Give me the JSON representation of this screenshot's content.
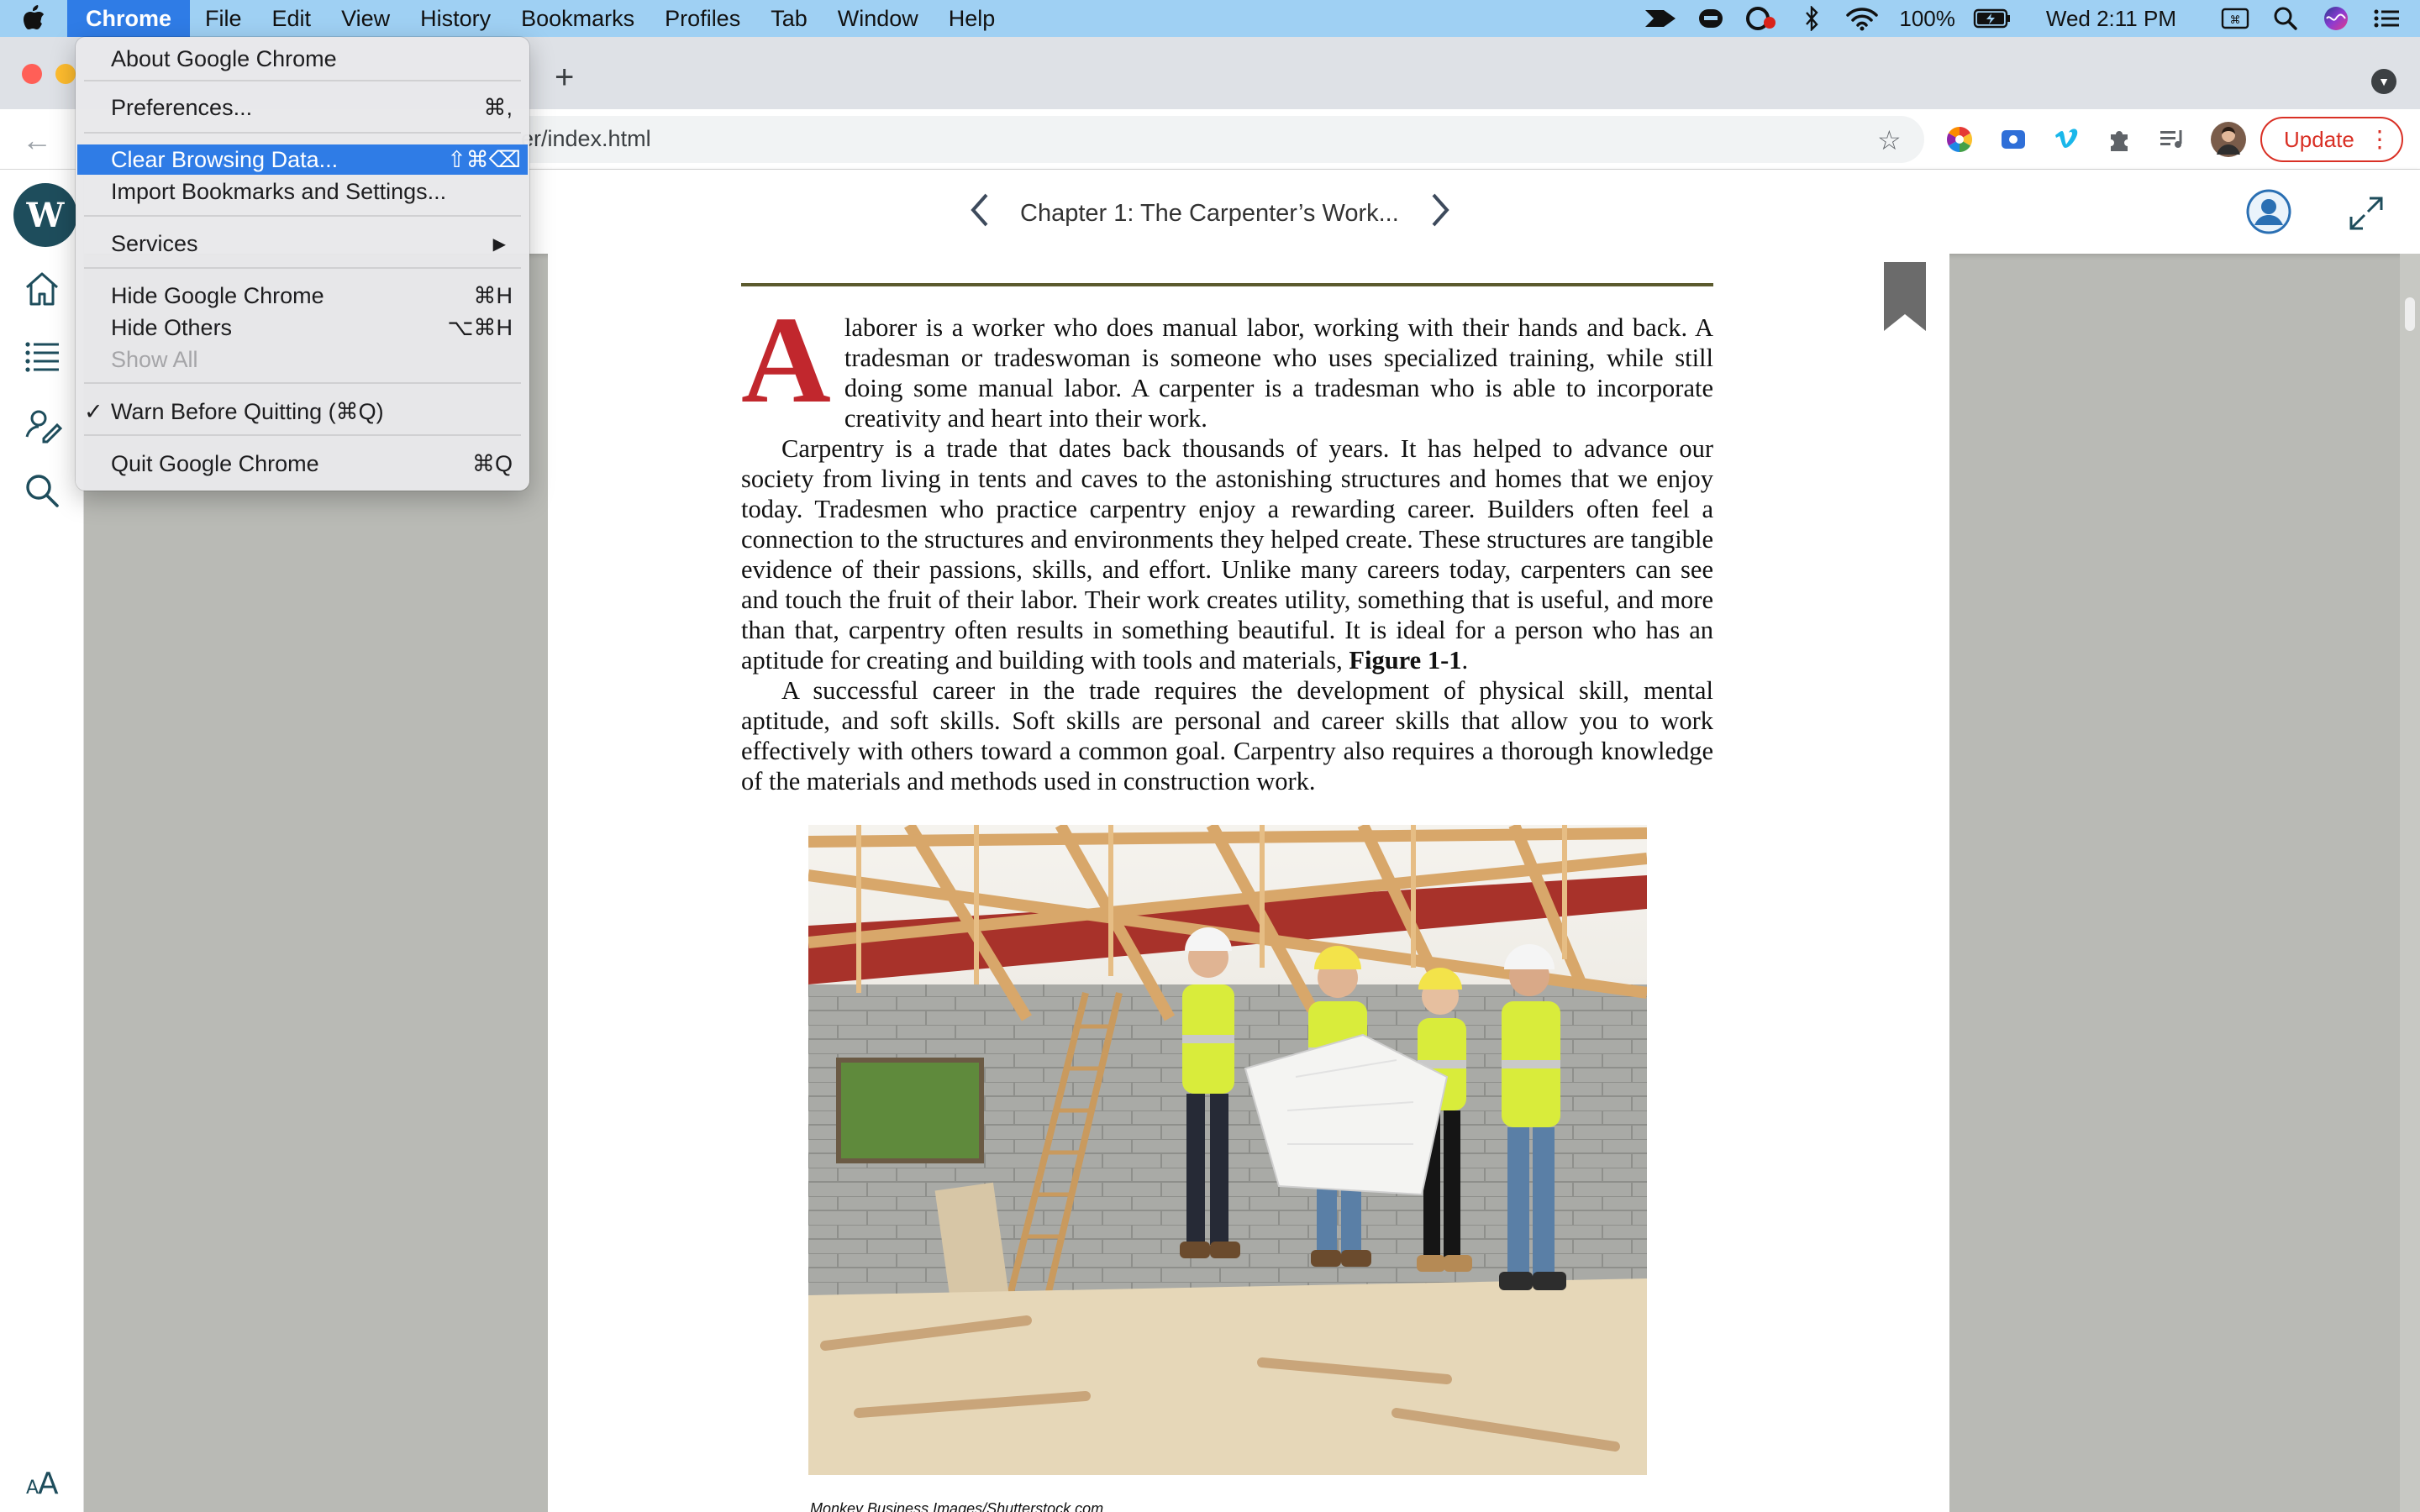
{
  "menubar": {
    "app": "Chrome",
    "items": [
      "File",
      "Edit",
      "View",
      "History",
      "Bookmarks",
      "Profiles",
      "Tab",
      "Window",
      "Help"
    ],
    "battery": "100%",
    "clock": "Wed 2:11 PM"
  },
  "app_menu": {
    "items": [
      {
        "label": "About Google Chrome",
        "shortcut": ""
      },
      {
        "label": "Preferences...",
        "shortcut": "⌘,"
      },
      {
        "label": "Clear Browsing Data...",
        "shortcut": "⇧⌘⌫"
      },
      {
        "label": "Import Bookmarks and Settings...",
        "shortcut": ""
      },
      {
        "label": "Services",
        "shortcut": "▶"
      },
      {
        "label": "Hide Google Chrome",
        "shortcut": "⌘H"
      },
      {
        "label": "Hide Others",
        "shortcut": "⌥⌘H"
      },
      {
        "label": "Show All",
        "shortcut": ""
      },
      {
        "label": "Warn Before Quitting (⌘Q)",
        "shortcut": "",
        "check": "✓"
      },
      {
        "label": "Quit Google Chrome",
        "shortcut": "⌘Q"
      }
    ]
  },
  "browser": {
    "url": "er/index.html",
    "update_label": "Update"
  },
  "reader": {
    "chapter_title": "Chapter 1: The Carpenter’s Work...",
    "logo": "W",
    "font_icon_label": "AA",
    "dropcap": "A",
    "para1": "laborer is a worker who does manual labor, working with their hands and back. A tradesman or tradeswoman is someone who uses specialized training, while still doing some manual labor. A carpenter is a tradesman who is able to incorporate creativity and heart into their work.",
    "para2_before": "Carpentry is a trade that dates back thousands of years. It has helped to advance our society from living in tents and caves to the astonishing structures and homes that we enjoy today. Tradesmen who practice carpentry enjoy a rewarding career. Builders often feel a connection to the structures and environments they helped create. These structures are tangible evidence of their passions, skills, and effort. Unlike many careers today, carpenters can see and touch the fruit of their labor. Their work creates utility, something that is useful, and more than that, carpentry often results in something beautiful. It is ideal for a person who has an aptitude for creating and building with tools and materials, ",
    "para2_fig": "Figure 1-1",
    "para2_after": ".",
    "para3": "A successful career in the trade requires the development of physical skill, mental aptitude, and soft skills. Soft skills are personal and career skills that allow you to work effectively with others toward a common goal. Carpentry also requires a thorough knowledge of the materials and methods used in construction work.",
    "photo_credit": "Monkey Business Images/Shutterstock.com"
  },
  "colors": {
    "menubar": "#9fd0f3",
    "highlight": "#2f7ce6",
    "dropcap": "#c1272d",
    "update": "#d93025",
    "logo": "#1e4d5c"
  }
}
